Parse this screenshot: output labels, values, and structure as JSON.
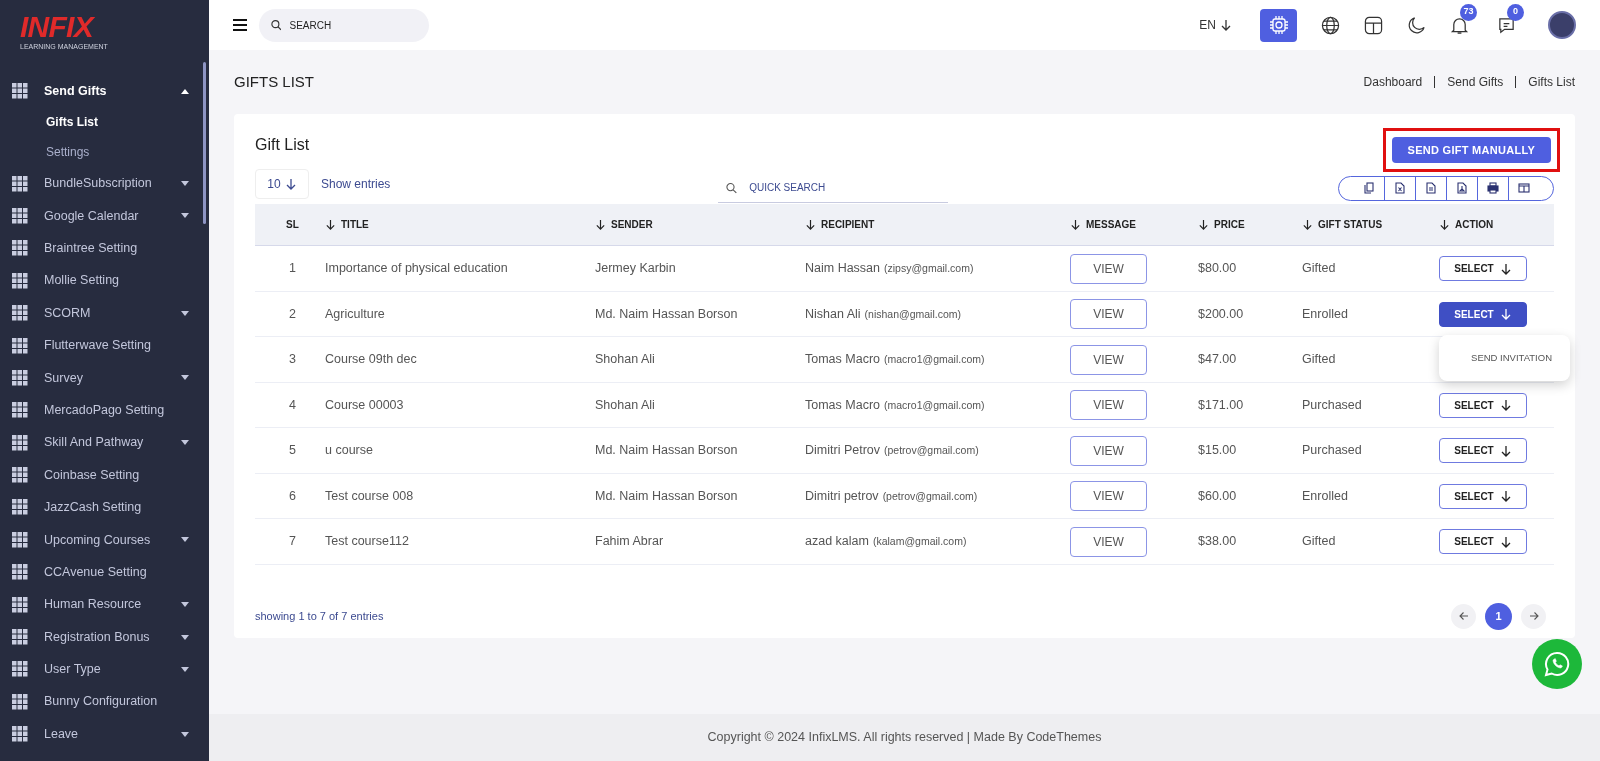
{
  "logo": {
    "brand": "INFIX",
    "tagline": "LEARNING MANAGEMENT"
  },
  "sidebar": {
    "items": [
      {
        "label": "Send Gifts",
        "expanded": true,
        "children": [
          {
            "label": "Gifts List",
            "selected": true
          },
          {
            "label": "Settings",
            "selected": false
          }
        ]
      },
      {
        "label": "BundleSubscription",
        "expanded": false
      },
      {
        "label": "Google Calendar",
        "expanded": false
      },
      {
        "label": "Braintree Setting"
      },
      {
        "label": "Mollie Setting"
      },
      {
        "label": "SCORM",
        "expanded": false
      },
      {
        "label": "Flutterwave Setting"
      },
      {
        "label": "Survey",
        "expanded": false
      },
      {
        "label": "MercadoPago Setting"
      },
      {
        "label": "Skill And Pathway",
        "expanded": false
      },
      {
        "label": "Coinbase Setting"
      },
      {
        "label": "JazzCash Setting"
      },
      {
        "label": "Upcoming Courses",
        "expanded": false
      },
      {
        "label": "CCAvenue Setting"
      },
      {
        "label": "Human Resource",
        "expanded": false
      },
      {
        "label": "Registration Bonus",
        "expanded": false
      },
      {
        "label": "User Type",
        "expanded": false
      },
      {
        "label": "Bunny Configuration"
      },
      {
        "label": "Leave",
        "expanded": false
      }
    ]
  },
  "topbar": {
    "search": {
      "placeholder": "SEARCH"
    },
    "language": "EN",
    "notifications": "73",
    "messages": "0"
  },
  "page": {
    "title": "GIFTS LIST",
    "breadcrumb": [
      "Dashboard",
      "Send Gifts",
      "Gifts List"
    ]
  },
  "card": {
    "title": "Gift List",
    "send_button": "SEND GIFT MANUALLY",
    "entries": "10",
    "entries_label": "Show entries",
    "quick_search": {
      "placeholder": "QUICK SEARCH"
    },
    "table": {
      "columns": [
        "SL",
        "TITLE",
        "SENDER",
        "RECIPIENT",
        "MESSAGE",
        "PRICE",
        "GIFT STATUS",
        "ACTION"
      ],
      "rows": [
        {
          "sl": "1",
          "title": "Importance of physical education",
          "sender": "Jermey Karbin",
          "recipient": "Naim Hassan",
          "email": "(zipsy@gmail.com)",
          "message": "VIEW",
          "price": "$80.00",
          "status": "Gifted",
          "action": "SELECT",
          "open": false
        },
        {
          "sl": "2",
          "title": "Agriculture",
          "sender": "Md. Naim Hassan Borson",
          "recipient": "Nishan Ali",
          "email": "(nishan@gmail.com)",
          "message": "VIEW",
          "price": "$200.00",
          "status": "Enrolled",
          "action": "SELECT",
          "open": true,
          "menu": [
            "SEND INVITATION"
          ]
        },
        {
          "sl": "3",
          "title": "Course 09th dec",
          "sender": "Shohan Ali",
          "recipient": "Tomas Macro",
          "email": "(macro1@gmail.com)",
          "message": "VIEW",
          "price": "$47.00",
          "status": "Gifted"
        },
        {
          "sl": "4",
          "title": "Course 00003",
          "sender": "Shohan Ali",
          "recipient": "Tomas Macro",
          "email": "(macro1@gmail.com)",
          "message": "VIEW",
          "price": "$171.00",
          "status": "Purchased",
          "action": "SELECT",
          "open": false
        },
        {
          "sl": "5",
          "title": "u course",
          "sender": "Md. Naim Hassan Borson",
          "recipient": "Dimitri Petrov",
          "email": "(petrov@gmail.com)",
          "message": "VIEW",
          "price": "$15.00",
          "status": "Purchased",
          "action": "SELECT",
          "open": false
        },
        {
          "sl": "6",
          "title": "Test course 008",
          "sender": "Md. Naim Hassan Borson",
          "recipient": "Dimitri petrov",
          "email": "(petrov@gmail.com)",
          "message": "VIEW",
          "price": "$60.00",
          "status": "Enrolled",
          "action": "SELECT",
          "open": false
        },
        {
          "sl": "7",
          "title": "Test course112",
          "sender": "Fahim Abrar",
          "recipient": "azad kalam",
          "email": "(kalam@gmail.com)",
          "message": "VIEW",
          "price": "$38.00",
          "status": "Gifted",
          "action": "SELECT",
          "open": false
        }
      ]
    },
    "summary": "showing 1 to 7 of 7 entries",
    "pages": [
      {
        "label": "1",
        "selected": true
      }
    ]
  },
  "footer": "Copyright © 2024 InfixLMS. All rights reserved | Made By CodeThemes"
}
